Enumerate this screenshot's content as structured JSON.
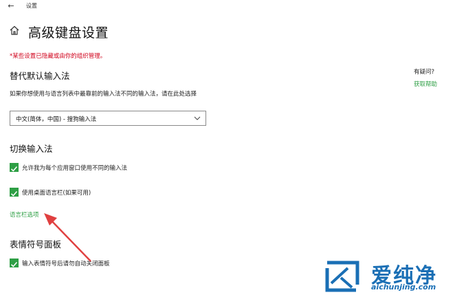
{
  "window": {
    "title": "设置"
  },
  "page": {
    "title": "高级键盘设置"
  },
  "notice": "*某些设置已隐藏或由你的组织管理。",
  "override": {
    "heading": "替代默认输入法",
    "description": "如果你想使用与语言列表中最靠前的输入法不同的输入法，请在此处选择",
    "selected": "中文(简体，中国) - 搜狗输入法"
  },
  "switching": {
    "heading": "切换输入法",
    "options": [
      {
        "label": "允许我为每个应用窗口使用不同的输入法",
        "checked": true
      },
      {
        "label": "使用桌面语言栏(如果可用)",
        "checked": true
      }
    ],
    "link": "语言栏选项"
  },
  "emoji": {
    "heading": "表情符号面板",
    "option": {
      "label": "输入表情符号后请勿自动关闭面板",
      "checked": true
    }
  },
  "help": {
    "question": "有疑问?",
    "link": "获取帮助"
  },
  "watermark": {
    "name": "爱纯净",
    "url": "aichunjing.com"
  },
  "colors": {
    "accent": "#2e9f45",
    "notice": "#d0021b",
    "arrow": "#e04040",
    "watermark": "#1a6fb5"
  },
  "icons": [
    "back-arrow-icon",
    "home-icon",
    "chevron-down-icon",
    "checkmark-icon",
    "watermark-logo-icon"
  ]
}
